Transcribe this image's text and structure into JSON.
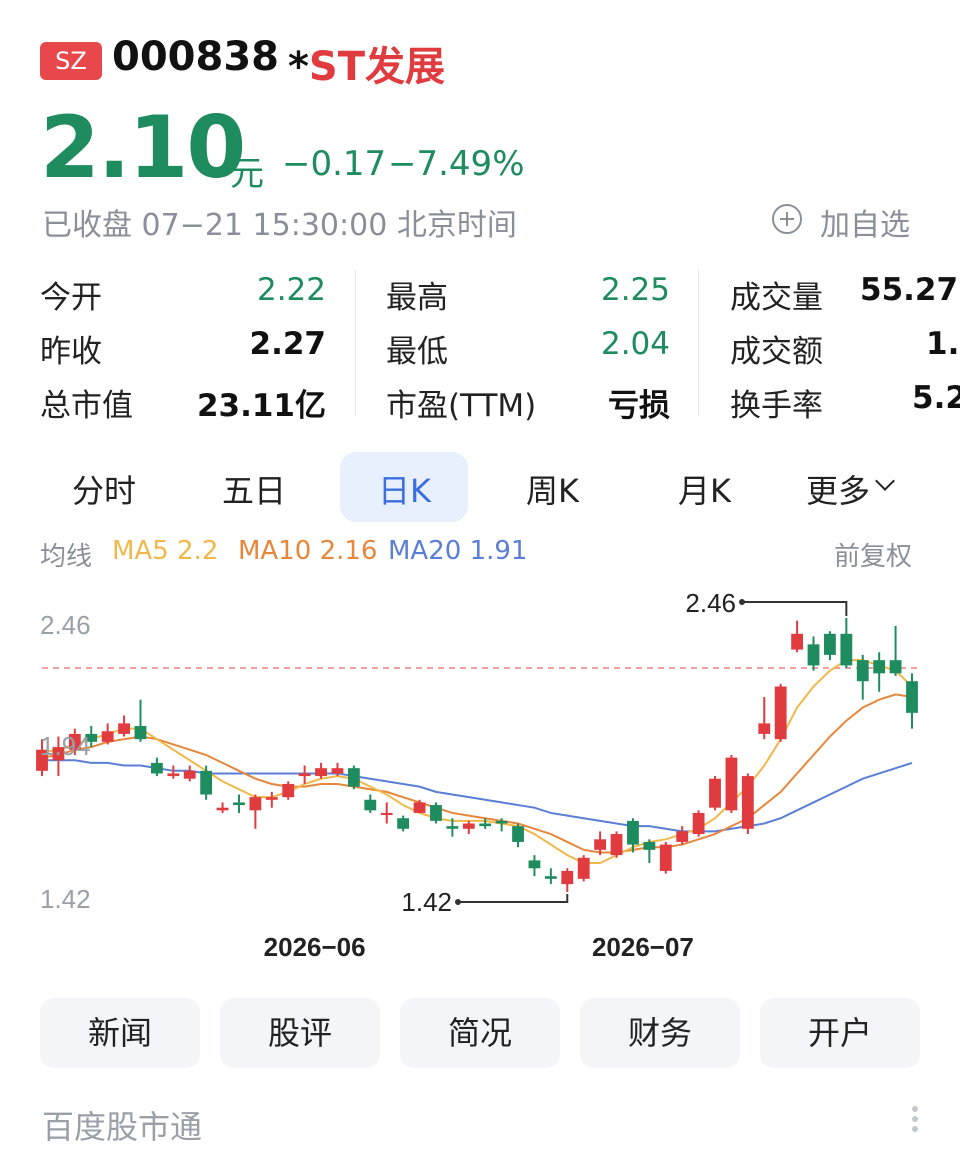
{
  "header": {
    "exchange_badge": "SZ",
    "code": "000838",
    "name_prefix": "*",
    "name": "ST发展"
  },
  "quote": {
    "price": "2.10",
    "unit": "元",
    "change": "−0.17",
    "change_pct": "−7.49%",
    "status": "已收盘 07−21 15:30:00 北京时间",
    "watch_label": "加自选"
  },
  "stats": {
    "col1": [
      {
        "label": "今开",
        "value": "2.22"
      },
      {
        "label": "昨收",
        "value": "2.27"
      },
      {
        "label": "总市值",
        "value": "23.11亿"
      }
    ],
    "col2": [
      {
        "label": "最高",
        "value": "2.25"
      },
      {
        "label": "最低",
        "value": "2.04"
      },
      {
        "label": "市盈(TTM)",
        "value": "亏损"
      }
    ],
    "col3": [
      {
        "label": "成交量",
        "value": "55.27"
      },
      {
        "label": "成交额",
        "value": "1."
      },
      {
        "label": "换手率",
        "value": "5.2"
      }
    ]
  },
  "tabs": [
    "分时",
    "五日",
    "日K",
    "周K",
    "月K",
    "更多"
  ],
  "active_tab": "日K",
  "ma_bar": {
    "label": "均线",
    "ma5": "MA5 2.2",
    "ma10": "MA10 2.16",
    "ma20": "MA20 1.91",
    "adjust": "前复权"
  },
  "colors": {
    "up": "#e03b3e",
    "down": "#1f8c60",
    "ma5": "#f0b84a",
    "ma10": "#e6873c",
    "ma20": "#5b7fd6",
    "prev_close_line": "#f2a0a2"
  },
  "chart_data": {
    "type": "candlestick",
    "y_axis_labels": [
      "2.46",
      "1.94",
      "1.42"
    ],
    "ylim": [
      1.42,
      2.46
    ],
    "x_labels": [
      "2026−06",
      "2026−07"
    ],
    "high_marker": "2.46",
    "low_marker": "1.42",
    "prev_close": 2.27,
    "candles": [
      {
        "o": 1.88,
        "c": 1.96,
        "h": 2.0,
        "l": 1.86
      },
      {
        "o": 1.92,
        "c": 1.97,
        "h": 2.01,
        "l": 1.86
      },
      {
        "o": 1.96,
        "c": 2.02,
        "h": 2.04,
        "l": 1.94
      },
      {
        "o": 2.02,
        "c": 1.99,
        "h": 2.05,
        "l": 1.97
      },
      {
        "o": 1.99,
        "c": 2.03,
        "h": 2.06,
        "l": 1.98
      },
      {
        "o": 2.02,
        "c": 2.06,
        "h": 2.09,
        "l": 2.01
      },
      {
        "o": 2.05,
        "c": 2.0,
        "h": 2.15,
        "l": 1.99
      },
      {
        "o": 1.91,
        "c": 1.87,
        "h": 1.93,
        "l": 1.86
      },
      {
        "o": 1.86,
        "c": 1.87,
        "h": 1.9,
        "l": 1.85
      },
      {
        "o": 1.85,
        "c": 1.88,
        "h": 1.9,
        "l": 1.84
      },
      {
        "o": 1.88,
        "c": 1.79,
        "h": 1.9,
        "l": 1.77
      },
      {
        "o": 1.73,
        "c": 1.74,
        "h": 1.76,
        "l": 1.72
      },
      {
        "o": 1.76,
        "c": 1.75,
        "h": 1.79,
        "l": 1.72
      },
      {
        "o": 1.73,
        "c": 1.78,
        "h": 1.79,
        "l": 1.66
      },
      {
        "o": 1.77,
        "c": 1.78,
        "h": 1.8,
        "l": 1.74
      },
      {
        "o": 1.78,
        "c": 1.83,
        "h": 1.84,
        "l": 1.77
      },
      {
        "o": 1.86,
        "c": 1.87,
        "h": 1.9,
        "l": 1.83
      },
      {
        "o": 1.86,
        "c": 1.89,
        "h": 1.91,
        "l": 1.85
      },
      {
        "o": 1.87,
        "c": 1.89,
        "h": 1.91,
        "l": 1.86
      },
      {
        "o": 1.89,
        "c": 1.82,
        "h": 1.9,
        "l": 1.81
      },
      {
        "o": 1.77,
        "c": 1.73,
        "h": 1.79,
        "l": 1.72
      },
      {
        "o": 1.72,
        "c": 1.72,
        "h": 1.76,
        "l": 1.68
      },
      {
        "o": 1.7,
        "c": 1.66,
        "h": 1.71,
        "l": 1.65
      },
      {
        "o": 1.72,
        "c": 1.76,
        "h": 1.77,
        "l": 1.72
      },
      {
        "o": 1.75,
        "c": 1.69,
        "h": 1.76,
        "l": 1.68
      },
      {
        "o": 1.67,
        "c": 1.66,
        "h": 1.7,
        "l": 1.63
      },
      {
        "o": 1.66,
        "c": 1.68,
        "h": 1.69,
        "l": 1.64
      },
      {
        "o": 1.68,
        "c": 1.67,
        "h": 1.7,
        "l": 1.66
      },
      {
        "o": 1.69,
        "c": 1.68,
        "h": 1.7,
        "l": 1.65
      },
      {
        "o": 1.67,
        "c": 1.61,
        "h": 1.68,
        "l": 1.59
      },
      {
        "o": 1.54,
        "c": 1.51,
        "h": 1.56,
        "l": 1.48
      },
      {
        "o": 1.48,
        "c": 1.47,
        "h": 1.51,
        "l": 1.45
      },
      {
        "o": 1.45,
        "c": 1.5,
        "h": 1.51,
        "l": 1.42
      },
      {
        "o": 1.47,
        "c": 1.55,
        "h": 1.56,
        "l": 1.46
      },
      {
        "o": 1.58,
        "c": 1.62,
        "h": 1.65,
        "l": 1.56
      },
      {
        "o": 1.56,
        "c": 1.64,
        "h": 1.65,
        "l": 1.55
      },
      {
        "o": 1.69,
        "c": 1.6,
        "h": 1.7,
        "l": 1.57
      },
      {
        "o": 1.61,
        "c": 1.58,
        "h": 1.62,
        "l": 1.53
      },
      {
        "o": 1.5,
        "c": 1.6,
        "h": 1.61,
        "l": 1.49
      },
      {
        "o": 1.61,
        "c": 1.65,
        "h": 1.67,
        "l": 1.6
      },
      {
        "o": 1.64,
        "c": 1.72,
        "h": 1.73,
        "l": 1.63
      },
      {
        "o": 1.74,
        "c": 1.85,
        "h": 1.86,
        "l": 1.73
      },
      {
        "o": 1.73,
        "c": 1.93,
        "h": 1.94,
        "l": 1.72
      },
      {
        "o": 1.66,
        "c": 1.86,
        "h": 1.87,
        "l": 1.64
      },
      {
        "o": 2.02,
        "c": 2.06,
        "h": 2.16,
        "l": 2.0
      },
      {
        "o": 2.0,
        "c": 2.2,
        "h": 2.21,
        "l": 1.99
      },
      {
        "o": 2.34,
        "c": 2.4,
        "h": 2.45,
        "l": 2.33
      },
      {
        "o": 2.36,
        "c": 2.28,
        "h": 2.39,
        "l": 2.26
      },
      {
        "o": 2.4,
        "c": 2.32,
        "h": 2.41,
        "l": 2.3
      },
      {
        "o": 2.4,
        "c": 2.28,
        "h": 2.46,
        "l": 2.27
      },
      {
        "o": 2.3,
        "c": 2.22,
        "h": 2.32,
        "l": 2.15
      },
      {
        "o": 2.3,
        "c": 2.25,
        "h": 2.33,
        "l": 2.18
      },
      {
        "o": 2.3,
        "c": 2.25,
        "h": 2.43,
        "l": 2.24
      },
      {
        "o": 2.22,
        "c": 2.1,
        "h": 2.25,
        "l": 2.04
      }
    ],
    "ma5": [
      1.95,
      1.96,
      1.98,
      2.0,
      2.02,
      2.04,
      2.04,
      2.0,
      1.96,
      1.92,
      1.88,
      1.84,
      1.81,
      1.78,
      1.78,
      1.8,
      1.83,
      1.85,
      1.86,
      1.85,
      1.82,
      1.79,
      1.75,
      1.72,
      1.7,
      1.69,
      1.69,
      1.69,
      1.68,
      1.67,
      1.64,
      1.6,
      1.56,
      1.53,
      1.53,
      1.56,
      1.59,
      1.61,
      1.62,
      1.64,
      1.66,
      1.7,
      1.76,
      1.82,
      1.9,
      2.0,
      2.12,
      2.2,
      2.26,
      2.3,
      2.3,
      2.28,
      2.26,
      2.2
    ],
    "ma10": [
      1.93,
      1.94,
      1.96,
      1.97,
      1.99,
      2.0,
      2.01,
      2.0,
      1.98,
      1.96,
      1.94,
      1.91,
      1.88,
      1.85,
      1.83,
      1.82,
      1.82,
      1.83,
      1.83,
      1.82,
      1.81,
      1.8,
      1.78,
      1.76,
      1.74,
      1.72,
      1.71,
      1.7,
      1.69,
      1.68,
      1.66,
      1.64,
      1.61,
      1.58,
      1.57,
      1.57,
      1.58,
      1.59,
      1.59,
      1.6,
      1.62,
      1.64,
      1.67,
      1.7,
      1.75,
      1.8,
      1.87,
      1.94,
      2.01,
      2.07,
      2.12,
      2.15,
      2.17,
      2.16
    ],
    "ma20": [
      1.92,
      1.92,
      1.92,
      1.91,
      1.91,
      1.9,
      1.9,
      1.89,
      1.88,
      1.88,
      1.87,
      1.87,
      1.87,
      1.87,
      1.87,
      1.87,
      1.87,
      1.87,
      1.87,
      1.86,
      1.85,
      1.84,
      1.83,
      1.82,
      1.8,
      1.79,
      1.78,
      1.77,
      1.76,
      1.75,
      1.74,
      1.72,
      1.71,
      1.7,
      1.69,
      1.68,
      1.67,
      1.67,
      1.66,
      1.65,
      1.65,
      1.65,
      1.66,
      1.67,
      1.68,
      1.7,
      1.73,
      1.76,
      1.79,
      1.82,
      1.85,
      1.87,
      1.89,
      1.91
    ]
  },
  "actions": [
    "新闻",
    "股评",
    "简况",
    "财务",
    "开户"
  ],
  "footer": {
    "brand": "百度股市通"
  }
}
